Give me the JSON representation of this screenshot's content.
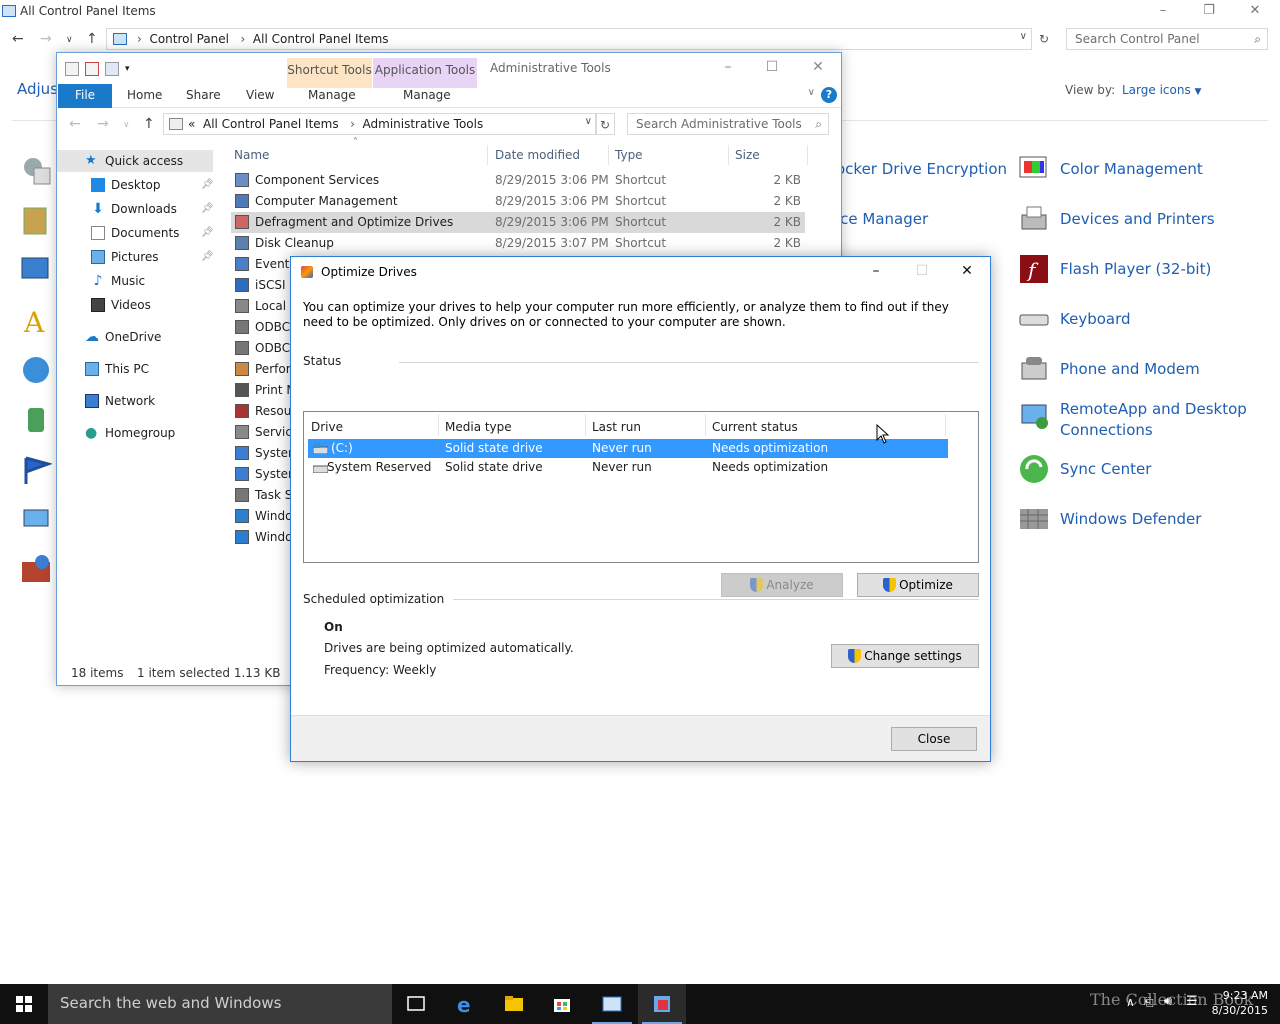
{
  "control_panel": {
    "title": "All Control Panel Items",
    "breadcrumb": [
      "Control Panel",
      "All Control Panel Items"
    ],
    "search_placeholder": "Search Control Panel",
    "heading": "Adjus",
    "view_by_label": "View by:",
    "view_by_value": "Large icons",
    "middle_items": [
      "ocker Drive Encryption",
      "ice Manager"
    ],
    "right_items": [
      "Color Management",
      "Devices and Printers",
      "Flash Player (32-bit)",
      "Keyboard",
      "Phone and Modem",
      "RemoteApp and Desktop",
      "Connections",
      "Sync Center",
      "Windows Defender"
    ]
  },
  "explorer": {
    "title": "Administrative Tools",
    "ribbon_ctx1": "Shortcut Tools",
    "ribbon_ctx2": "Application Tools",
    "tabs": {
      "file": "File",
      "home": "Home",
      "share": "Share",
      "view": "View",
      "manage1": "Manage",
      "manage2": "Manage"
    },
    "breadcrumb": [
      "«",
      "All Control Panel Items",
      "Administrative Tools"
    ],
    "search_placeholder": "Search Administrative Tools",
    "nav": {
      "quick_access": "Quick access",
      "desktop": "Desktop",
      "downloads": "Downloads",
      "documents": "Documents",
      "pictures": "Pictures",
      "music": "Music",
      "videos": "Videos",
      "onedrive": "OneDrive",
      "this_pc": "This PC",
      "network": "Network",
      "homegroup": "Homegroup"
    },
    "columns": {
      "name": "Name",
      "date": "Date modified",
      "type": "Type",
      "size": "Size"
    },
    "files": [
      {
        "name": "Component Services",
        "date": "8/29/2015 3:06 PM",
        "type": "Shortcut",
        "size": "2 KB"
      },
      {
        "name": "Computer Management",
        "date": "8/29/2015 3:06 PM",
        "type": "Shortcut",
        "size": "2 KB"
      },
      {
        "name": "Defragment and Optimize Drives",
        "date": "8/29/2015 3:06 PM",
        "type": "Shortcut",
        "size": "2 KB"
      },
      {
        "name": "Disk Cleanup",
        "date": "8/29/2015 3:07 PM",
        "type": "Shortcut",
        "size": "2 KB"
      },
      {
        "name": "Event V",
        "date": "",
        "type": "",
        "size": ""
      },
      {
        "name": "iSCSI In",
        "date": "",
        "type": "",
        "size": ""
      },
      {
        "name": "Local S",
        "date": "",
        "type": "",
        "size": ""
      },
      {
        "name": "ODBC",
        "date": "",
        "type": "",
        "size": ""
      },
      {
        "name": "ODBC",
        "date": "",
        "type": "",
        "size": ""
      },
      {
        "name": "Perforr",
        "date": "",
        "type": "",
        "size": ""
      },
      {
        "name": "Print M",
        "date": "",
        "type": "",
        "size": ""
      },
      {
        "name": "Resour",
        "date": "",
        "type": "",
        "size": ""
      },
      {
        "name": "Service",
        "date": "",
        "type": "",
        "size": ""
      },
      {
        "name": "System",
        "date": "",
        "type": "",
        "size": ""
      },
      {
        "name": "System",
        "date": "",
        "type": "",
        "size": ""
      },
      {
        "name": "Task Sc",
        "date": "",
        "type": "",
        "size": ""
      },
      {
        "name": "Windo",
        "date": "",
        "type": "",
        "size": ""
      },
      {
        "name": "Windo",
        "date": "",
        "type": "",
        "size": ""
      }
    ],
    "status_count": "18 items",
    "status_selected": "1 item selected  1.13 KB"
  },
  "dialog": {
    "title": "Optimize Drives",
    "description": "You can optimize your drives to help your computer run more efficiently, or analyze them to find out if they need to be optimized. Only drives on or connected to your computer are shown.",
    "status_label": "Status",
    "columns": {
      "drive": "Drive",
      "media": "Media type",
      "last_run": "Last run",
      "status": "Current status"
    },
    "drives": [
      {
        "drive": "(C:)",
        "media": "Solid state drive",
        "last_run": "Never run",
        "status": "Needs optimization"
      },
      {
        "drive": "System Reserved",
        "media": "Solid state drive",
        "last_run": "Never run",
        "status": "Needs optimization"
      }
    ],
    "analyze_label": "Analyze",
    "optimize_label": "Optimize",
    "scheduled_label": "Scheduled optimization",
    "sched_state": "On",
    "sched_desc": "Drives are being optimized automatically.",
    "sched_freq": "Frequency: Weekly",
    "change_settings_label": "Change settings",
    "close_label": "Close"
  },
  "taskbar": {
    "search_text": "Search the web and Windows",
    "time": "9:23 AM",
    "date": "8/30/2015",
    "watermark": "The Collection Book"
  },
  "colors": {
    "accent": "#1979ca",
    "selection": "#3399ff",
    "link": "#1e5eb3",
    "taskbar": "#101010"
  }
}
